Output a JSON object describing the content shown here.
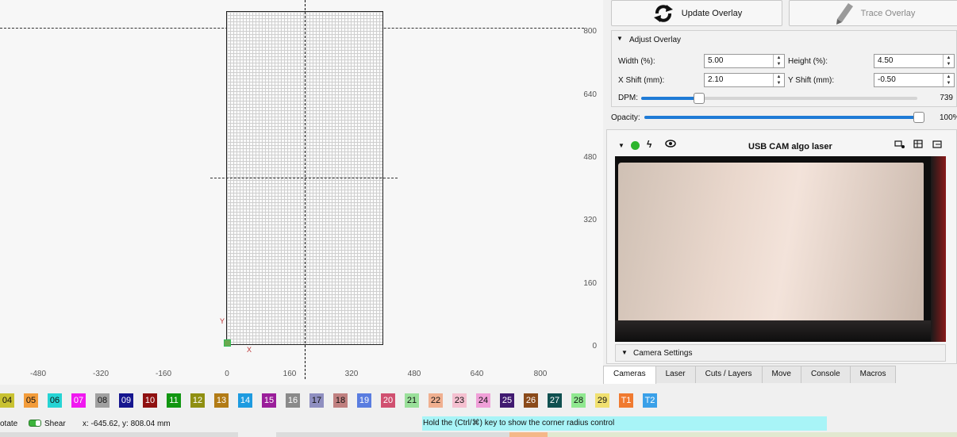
{
  "workspace": {
    "y_ticks": [
      "800",
      "640",
      "480",
      "320",
      "160",
      "0"
    ],
    "x_ticks": [
      "-480",
      "-320",
      "-160",
      "0",
      "160",
      "320",
      "480",
      "640",
      "800"
    ],
    "axis_y_label": "Y",
    "axis_x_label": "X"
  },
  "toolbar": {
    "update_overlay_label": "Update Overlay",
    "trace_overlay_label": "Trace Overlay"
  },
  "adjust_overlay": {
    "title": "Adjust Overlay",
    "width_label": "Width (%):",
    "width_value": "5.00",
    "height_label": "Height (%):",
    "height_value": "4.50",
    "xshift_label": "X Shift (mm):",
    "xshift_value": "2.10",
    "yshift_label": "Y Shift (mm):",
    "yshift_value": "-0.50",
    "dpm_label": "DPM:",
    "dpm_value": "739",
    "dpm_fraction": 0.21
  },
  "opacity": {
    "label": "Opacity:",
    "value": "100%",
    "fraction": 1.0
  },
  "camera": {
    "title": "USB CAM algo laser",
    "settings_label": "Camera Settings",
    "status_color": "#2db52d"
  },
  "tabs": [
    "Cameras",
    "Laser",
    "Cuts / Layers",
    "Move",
    "Console",
    "Macros"
  ],
  "palette": [
    {
      "label": "04",
      "color": "#c9c232"
    },
    {
      "label": "05",
      "color": "#f39c3a"
    },
    {
      "label": "06",
      "color": "#26d4d4"
    },
    {
      "label": "07",
      "color": "#f018f0"
    },
    {
      "label": "08",
      "color": "#a0a0a0"
    },
    {
      "label": "09",
      "color": "#16168f"
    },
    {
      "label": "10",
      "color": "#8f1111"
    },
    {
      "label": "11",
      "color": "#119611"
    },
    {
      "label": "12",
      "color": "#8f8f11"
    },
    {
      "label": "13",
      "color": "#b27b16"
    },
    {
      "label": "14",
      "color": "#1e9be0"
    },
    {
      "label": "15",
      "color": "#9a1e9a"
    },
    {
      "label": "16",
      "color": "#8a8a8a"
    },
    {
      "label": "17",
      "color": "#8f8fc0"
    },
    {
      "label": "18",
      "color": "#c08080"
    },
    {
      "label": "19",
      "color": "#5a7de0"
    },
    {
      "label": "20",
      "color": "#d05070"
    },
    {
      "label": "21",
      "color": "#9ae09a"
    },
    {
      "label": "22",
      "color": "#f0b090"
    },
    {
      "label": "23",
      "color": "#f5c0d0"
    },
    {
      "label": "24",
      "color": "#f0a0d8"
    },
    {
      "label": "25",
      "color": "#401a70"
    },
    {
      "label": "26",
      "color": "#8a4a1a"
    },
    {
      "label": "27",
      "color": "#105050"
    },
    {
      "label": "28",
      "color": "#90e890"
    },
    {
      "label": "29",
      "color": "#f0e070"
    },
    {
      "label": "T1",
      "color": "#f07a30"
    },
    {
      "label": "T2",
      "color": "#3aa0e8"
    }
  ],
  "status": {
    "rotate_label": "otate",
    "shear_label": "Shear",
    "coords": "x: -645.62, y: 808.04 mm",
    "hint": "Hold the (Ctrl/⌘) key to show the corner radius control"
  }
}
